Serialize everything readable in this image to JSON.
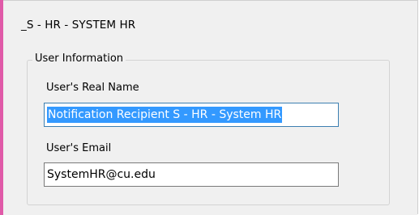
{
  "window": {
    "title": "_S - HR - SYSTEM HR"
  },
  "user_information": {
    "group_label": "User Information",
    "real_name": {
      "label": "User's Real Name",
      "value": "Notification Recipient S - HR - System HR",
      "selected": true
    },
    "email": {
      "label": "User's Email",
      "value": "SystemHR@cu.edu"
    }
  },
  "colors": {
    "accent_bar": "#e05aa8",
    "selection": "#3399ff",
    "panel_background": "#f0f0f0"
  }
}
